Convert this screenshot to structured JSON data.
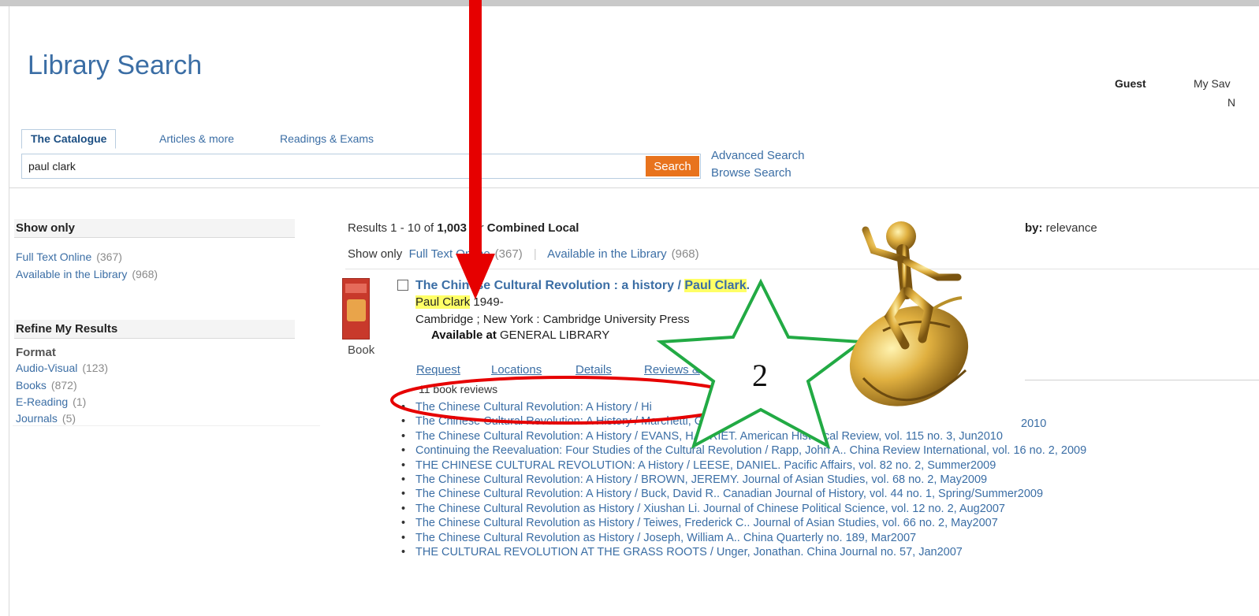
{
  "header": {
    "app_title": "Library Search",
    "user_label": "Guest",
    "saved_label": "My Sav",
    "right_fragment": "N"
  },
  "search": {
    "tabs": [
      "The Catalogue",
      "Articles & more",
      "Readings & Exams"
    ],
    "query": "paul clark",
    "button_label": "Search",
    "advanced_label": "Advanced Search",
    "browse_label": "Browse Search"
  },
  "sidebar": {
    "show_only_heading": "Show only",
    "show_only_items": [
      {
        "label": "Full Text Online",
        "count": "(367)"
      },
      {
        "label": "Available in the Library",
        "count": "(968)"
      }
    ],
    "refine_heading": "Refine My Results",
    "format_label": "Format",
    "format_items": [
      {
        "label": "Audio-Visual",
        "count": "(123)"
      },
      {
        "label": "Books",
        "count": "(872)"
      },
      {
        "label": "E-Reading",
        "count": "(1)"
      },
      {
        "label": "Journals",
        "count": "(5)"
      }
    ]
  },
  "results": {
    "summary_prefix": "Results 1 - 10 of",
    "summary_total": "1,003",
    "summary_middle": "for",
    "summary_scope": "Combined Local",
    "sort_label": "by:",
    "sort_value": "relevance",
    "show_only_label": "Show only",
    "show_only_links": [
      {
        "label": "Full Text Online",
        "count": "(367)"
      },
      {
        "label": "Available in the Library",
        "count": "(968)"
      }
    ]
  },
  "record": {
    "format": "Book",
    "title_prefix": "The Chinese Cultural Revolution : a history / ",
    "title_highlight": "Paul Clark",
    "title_suffix": ".",
    "author_highlight": "Paul Clark",
    "author_suffix": " 1949-",
    "publisher": "Cambridge ; New York : Cambridge University Press",
    "available_label": "Available at",
    "available_location": "GENERAL LIBRARY",
    "tabs": [
      "Request",
      "Locations",
      "Details",
      "Reviews &"
    ],
    "reviews_count": "11 book reviews",
    "reviews": [
      "The Chinese Cultural Revolution: A History / Hi",
      "The Chinese Cultural Revolution: A History / Marchetti, Gina.",
      "The Chinese Cultural Revolution: A History / EVANS, HARRIET. American Historical Review, vol. 115 no. 3, Jun2010",
      "Continuing the Reevaluation: Four Studies of the Cultural Revolution / Rapp, John A.. China Review International, vol. 16 no. 2, 2009",
      "THE CHINESE CULTURAL REVOLUTION: A History / LEESE, DANIEL. Pacific Affairs, vol. 82 no. 2, Summer2009",
      "The Chinese Cultural Revolution: A History / BROWN, JEREMY. Journal of Asian Studies, vol. 68 no. 2, May2009",
      "The Chinese Cultural Revolution: A History / Buck, David R.. Canadian Journal of History, vol. 44 no. 1, Spring/Summer2009",
      "The Chinese Cultural Revolution as History / Xiushan Li. Journal of Chinese Political Science, vol. 12 no. 2, Aug2007",
      "The Chinese Cultural Revolution as History / Teiwes, Frederick C.. Journal of Asian Studies, vol. 66 no. 2, May2007",
      "The Chinese Cultural Revolution as History / Joseph, William A.. China Quarterly no. 189, Mar2007",
      "THE CULTURAL REVOLUTION AT THE GRASS ROOTS / Unger, Jonathan. China Journal no. 57, Jan2007"
    ],
    "review_fragment_right": "2010"
  },
  "annotations": {
    "star_number": "2",
    "arrow_color": "#e60000",
    "star_color": "#22aa44",
    "ellipse_color": "#e60000"
  },
  "colors": {
    "link": "#3b6ea5",
    "search_button": "#e8731d",
    "highlight": "#ffff66"
  }
}
